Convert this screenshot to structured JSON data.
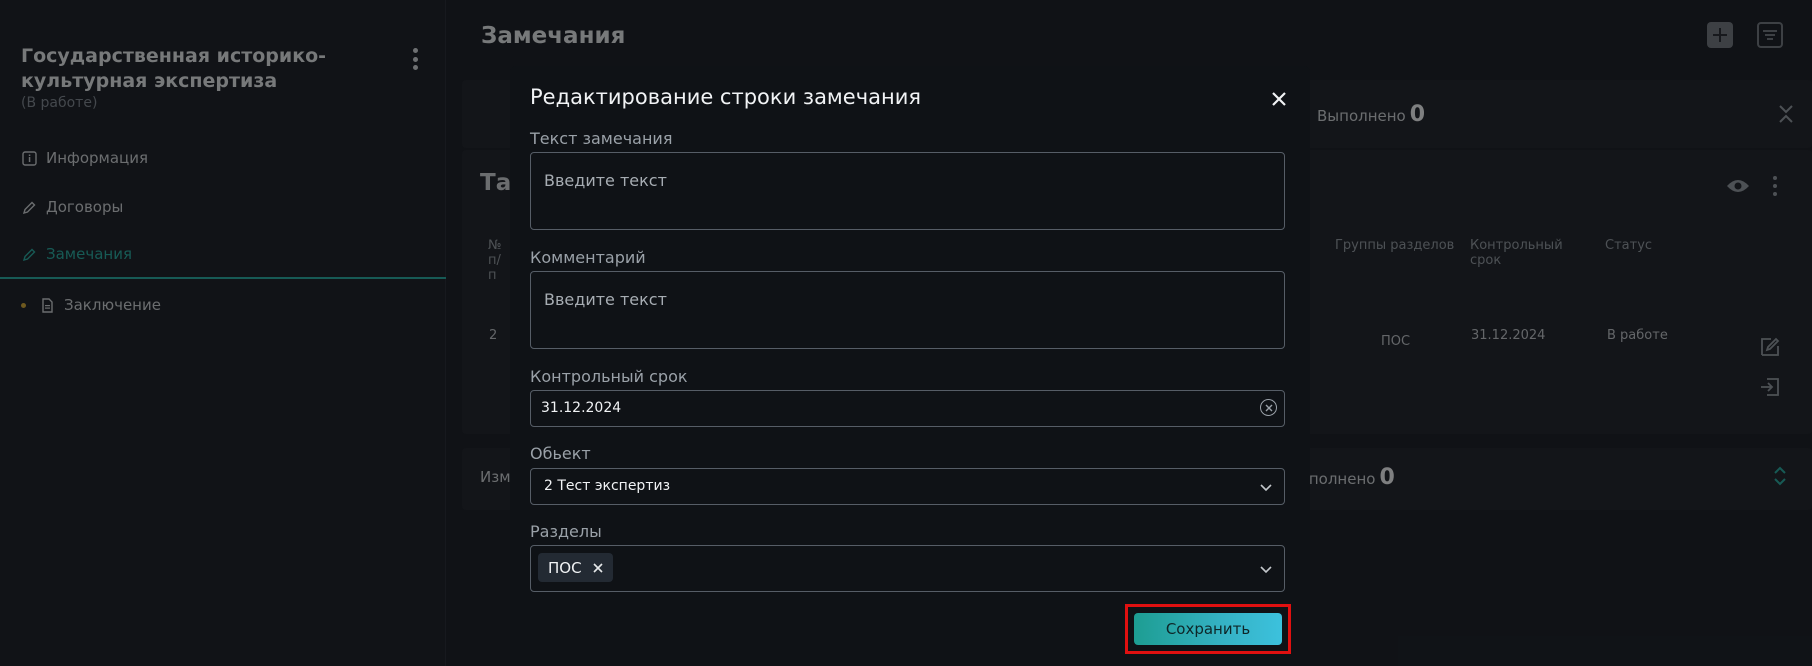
{
  "sidebar": {
    "project_title": "Государственная историко-культурная экспертиза",
    "project_status": "(В работе)",
    "items": [
      {
        "label": "Информация",
        "icon": "info-icon"
      },
      {
        "label": "Договоры",
        "icon": "pen-icon"
      },
      {
        "label": "Замечания",
        "icon": "pen-icon",
        "active": true
      },
      {
        "label": "Заключение",
        "icon": "document-icon"
      }
    ]
  },
  "main": {
    "page_title": "Замечания",
    "summary_done_label": "Выполнено",
    "summary_done_value": "0",
    "table_title_fragment": "Таб",
    "changes_fragment": "Изм",
    "changes_done_label": "ыполнено",
    "changes_done_value": "0",
    "table_headers": {
      "num": "№ п/ п",
      "groups": "Группы разделов",
      "deadline": "Контрольный срок",
      "status": "Статус"
    },
    "row": {
      "num": "2",
      "groups": "ПОС",
      "deadline": "31.12.2024",
      "status": "В работе"
    }
  },
  "modal": {
    "title": "Редактирование строки замечания",
    "fields": {
      "remark_label": "Текст замечания",
      "remark_placeholder": "Введите текст",
      "comment_label": "Комментарий",
      "comment_placeholder": "Введите текст",
      "deadline_label": "Контрольный срок",
      "deadline_value": "31.12.2024",
      "object_label": "Обьект",
      "object_value": "2 Тест экспертиз",
      "sections_label": "Разделы",
      "sections_chip": "ПОС"
    },
    "save_label": "Сохранить"
  },
  "colors": {
    "accent": "#2aa59b",
    "highlight_border": "#e01010",
    "modal_bg": "#0f1216"
  }
}
